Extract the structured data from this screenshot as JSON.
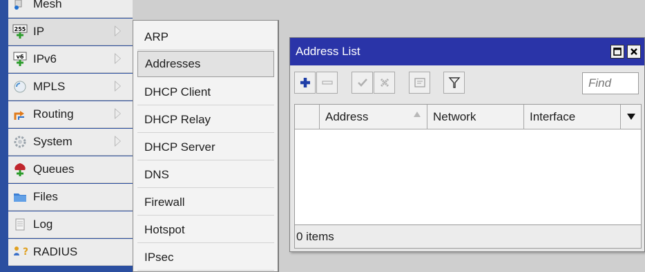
{
  "sidebar": {
    "items": [
      {
        "label": "Mesh",
        "icon": "mesh-icon"
      },
      {
        "label": "IP",
        "icon": "ip-icon",
        "icon_text": "255",
        "submenu": true,
        "active": true
      },
      {
        "label": "IPv6",
        "icon": "ipv6-icon",
        "icon_text": "v6",
        "submenu": true
      },
      {
        "label": "MPLS",
        "icon": "mpls-icon",
        "submenu": true
      },
      {
        "label": "Routing",
        "icon": "routing-icon",
        "submenu": true
      },
      {
        "label": "System",
        "icon": "system-icon",
        "submenu": true
      },
      {
        "label": "Queues",
        "icon": "queues-icon"
      },
      {
        "label": "Files",
        "icon": "files-icon"
      },
      {
        "label": "Log",
        "icon": "log-icon"
      },
      {
        "label": "RADIUS",
        "icon": "radius-icon"
      }
    ]
  },
  "submenu": {
    "items": [
      {
        "label": "ARP"
      },
      {
        "label": "Addresses",
        "selected": true
      },
      {
        "label": "DHCP Client"
      },
      {
        "label": "DHCP Relay"
      },
      {
        "label": "DHCP Server"
      },
      {
        "label": "DNS"
      },
      {
        "label": "Firewall"
      },
      {
        "label": "Hotspot"
      },
      {
        "label": "IPsec"
      }
    ]
  },
  "window": {
    "title": "Address List",
    "toolbar": {
      "buttons": [
        "add-icon",
        "remove-icon",
        "enable-icon",
        "disable-icon",
        "comment-icon",
        "filter-icon"
      ],
      "find_placeholder": "Find"
    },
    "table": {
      "columns": [
        "Address",
        "Network",
        "Interface"
      ],
      "rows": []
    },
    "status": "0 items"
  },
  "colors": {
    "sidebar_bg": "#2b4fa0",
    "titlebar_bg": "#2a34a8",
    "add_button": "#1f3fa8"
  }
}
